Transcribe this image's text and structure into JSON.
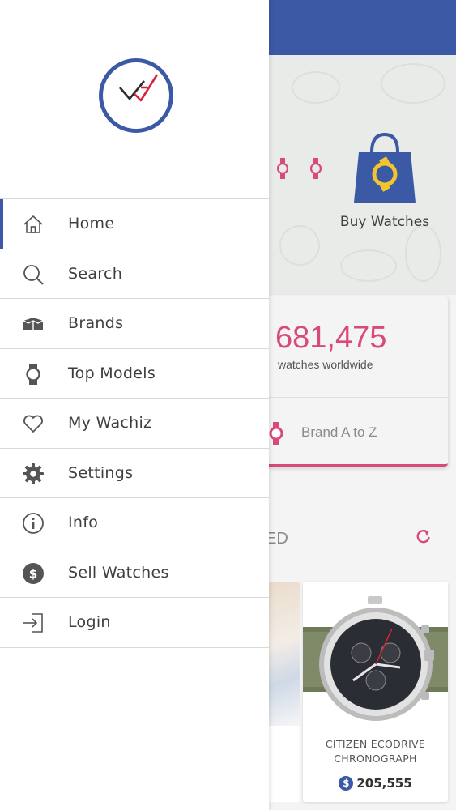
{
  "colors": {
    "primary": "#3b59a4",
    "accent": "#d94a7c",
    "text": "#3e3e3e",
    "divider": "#d8d8d8"
  },
  "drawer": {
    "logo_icon": "watch-check-logo-icon",
    "menu": [
      {
        "label": "Home",
        "icon": "home-icon",
        "active": true
      },
      {
        "label": "Search",
        "icon": "search-icon"
      },
      {
        "label": "Brands",
        "icon": "box-icon"
      },
      {
        "label": "Top Models",
        "icon": "watch-icon"
      },
      {
        "label": "My Wachiz",
        "icon": "heart-icon"
      },
      {
        "label": "Settings",
        "icon": "gear-icon"
      },
      {
        "label": "Info",
        "icon": "info-icon"
      },
      {
        "label": "Sell Watches",
        "icon": "dollar-icon"
      },
      {
        "label": "Login",
        "icon": "login-icon"
      }
    ]
  },
  "background": {
    "hero": {
      "buy_label": "Buy Watches",
      "icon": "shopping-bag-watch-icon"
    },
    "stats": {
      "count": "681,475",
      "caption": "watches worldwide",
      "brand_link": "Brand A to Z",
      "brand_icon": "watch-icon"
    },
    "section": {
      "title_fragment": "ED",
      "refresh_icon": "refresh-icon"
    },
    "product": {
      "name_line1": "CITIZEN ECODRIVE",
      "name_line2": "CHRONOGRAPH",
      "price": "205,555",
      "currency_symbol": "$"
    }
  }
}
